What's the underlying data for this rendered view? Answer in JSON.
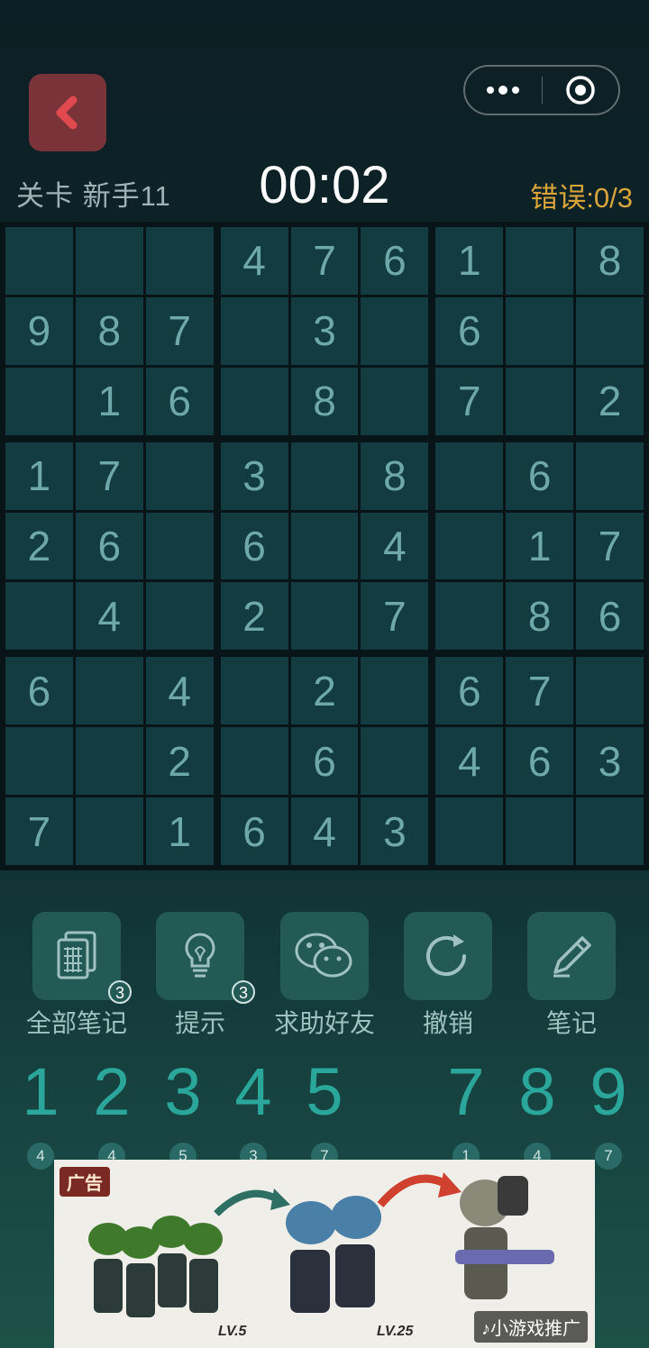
{
  "header": {
    "level_label": "关卡 新手11",
    "timer": "00:02",
    "errors_label": "错误:0/3"
  },
  "colors": {
    "background": "#0e2a2f",
    "cell": "#123c40",
    "digit": "#6fa8a8",
    "accent_number": "#2aa79a",
    "error_text": "#d9a53a",
    "back_button": "#7a3338"
  },
  "board": {
    "rows": [
      [
        "",
        "",
        "",
        "4",
        "7",
        "6",
        "1",
        "",
        "8"
      ],
      [
        "9",
        "8",
        "7",
        "",
        "3",
        "",
        "6",
        "",
        ""
      ],
      [
        "",
        "1",
        "6",
        "",
        "8",
        "",
        "7",
        "",
        "2"
      ],
      [
        "1",
        "7",
        "",
        "3",
        "",
        "8",
        "",
        "6",
        ""
      ],
      [
        "2",
        "6",
        "",
        "6",
        "",
        "4",
        "",
        "1",
        "7"
      ],
      [
        "",
        "4",
        "",
        "2",
        "",
        "7",
        "",
        "8",
        "6"
      ],
      [
        "6",
        "",
        "4",
        "",
        "2",
        "",
        "6",
        "7",
        ""
      ],
      [
        "",
        "",
        "2",
        "",
        "6",
        "",
        "4",
        "6",
        "3"
      ],
      [
        "7",
        "",
        "1",
        "6",
        "4",
        "3",
        "",
        "",
        ""
      ]
    ]
  },
  "tools": [
    {
      "label": "全部笔记",
      "icon": "notes-grid-icon",
      "badge": "3"
    },
    {
      "label": "提示",
      "icon": "lightbulb-icon",
      "badge": "3"
    },
    {
      "label": "求助好友",
      "icon": "wechat-icon",
      "badge": ""
    },
    {
      "label": "撤销",
      "icon": "undo-icon",
      "badge": ""
    },
    {
      "label": "笔记",
      "icon": "pencil-icon",
      "badge": ""
    }
  ],
  "number_pad": [
    {
      "digit": "1",
      "count": "4"
    },
    {
      "digit": "2",
      "count": "4"
    },
    {
      "digit": "3",
      "count": "5"
    },
    {
      "digit": "4",
      "count": "3"
    },
    {
      "digit": "5",
      "count": "7"
    },
    {
      "digit": "7",
      "count": "1"
    },
    {
      "digit": "8",
      "count": "4"
    },
    {
      "digit": "9",
      "count": "7"
    }
  ],
  "ad": {
    "tag": "广告",
    "level_a": "LV.5",
    "level_b": "LV.25",
    "promo": "小游戏推广"
  }
}
